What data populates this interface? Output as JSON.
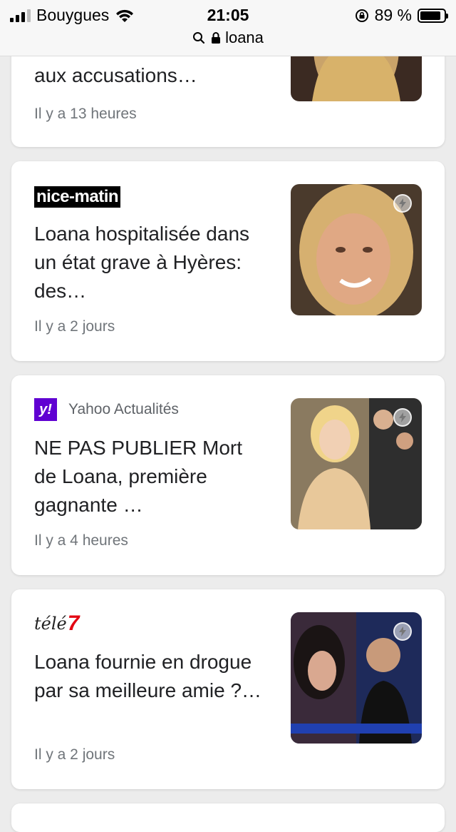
{
  "status_bar": {
    "carrier": "Bouygues",
    "time": "21:05",
    "battery_percent": "89 %",
    "battery_level": 0.89
  },
  "url_bar": {
    "query": "loana"
  },
  "colors": {
    "background": "#ececec",
    "card": "#ffffff",
    "meta_text": "#70757a",
    "yahoo_purple": "#6001d2",
    "tele7_red": "#e30613"
  },
  "cards": [
    {
      "title": "aux accusations…",
      "time_ago": "Il y a 13 heures",
      "thumbnail": "photo-icon"
    },
    {
      "source_logo_text": "nice-matin",
      "title": "Loana hospitalisée dans un état grave à Hyères: des…",
      "time_ago": "Il y a 2 jours",
      "thumbnail": "photo-icon"
    },
    {
      "source_logo_text": "y!",
      "source_name": "Yahoo Actualités",
      "title": "NE PAS PUBLIER Mort de Loana, première gagnante …",
      "time_ago": "Il y a 4 heures",
      "thumbnail": "photo-icon"
    },
    {
      "source_logo_text": "télé",
      "source_logo_accent": "7",
      "title": "Loana fournie en drogue par sa meilleure amie ?…",
      "time_ago": "Il y a 2 jours",
      "thumbnail": "photo-icon"
    }
  ]
}
